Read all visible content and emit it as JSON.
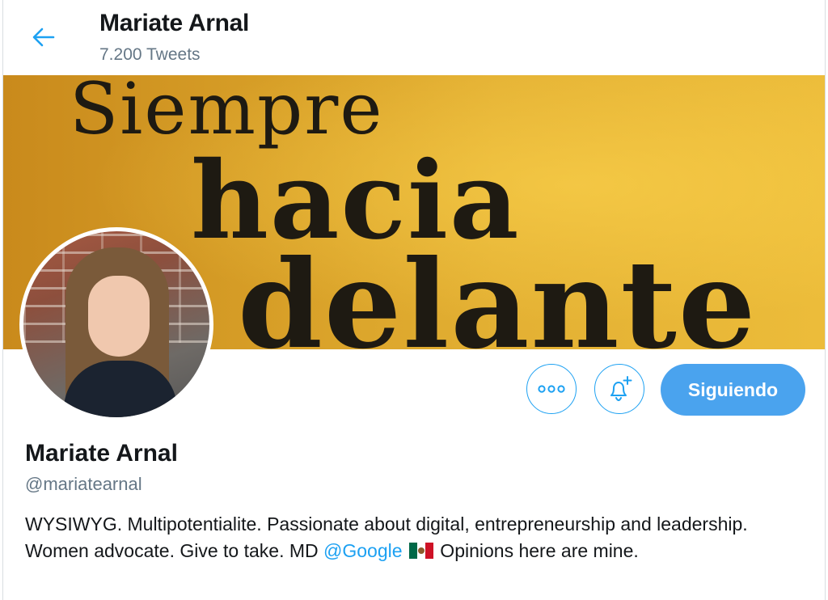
{
  "header": {
    "title": "Mariate Arnal",
    "tweet_count": "7.200 Tweets"
  },
  "banner": {
    "line1": "Siempre",
    "line2": "hacia",
    "line3": "delante"
  },
  "actions": {
    "more_icon": "more-dots-icon",
    "bell_icon": "bell-plus-icon",
    "follow_label": "Siguiendo"
  },
  "profile": {
    "name": "Mariate Arnal",
    "handle": "@mariatearnal",
    "bio_part1": "WYSIWYG. Multipotentialite.  Passionate about digital, entrepreneurship and leadership. Women advocate. Give to take. MD ",
    "bio_mention": "@Google",
    "bio_part2": " Opinions here are mine."
  },
  "colors": {
    "accent": "#1da1f2",
    "follow_button": "#4aa3ee",
    "secondary_text": "#657786"
  }
}
